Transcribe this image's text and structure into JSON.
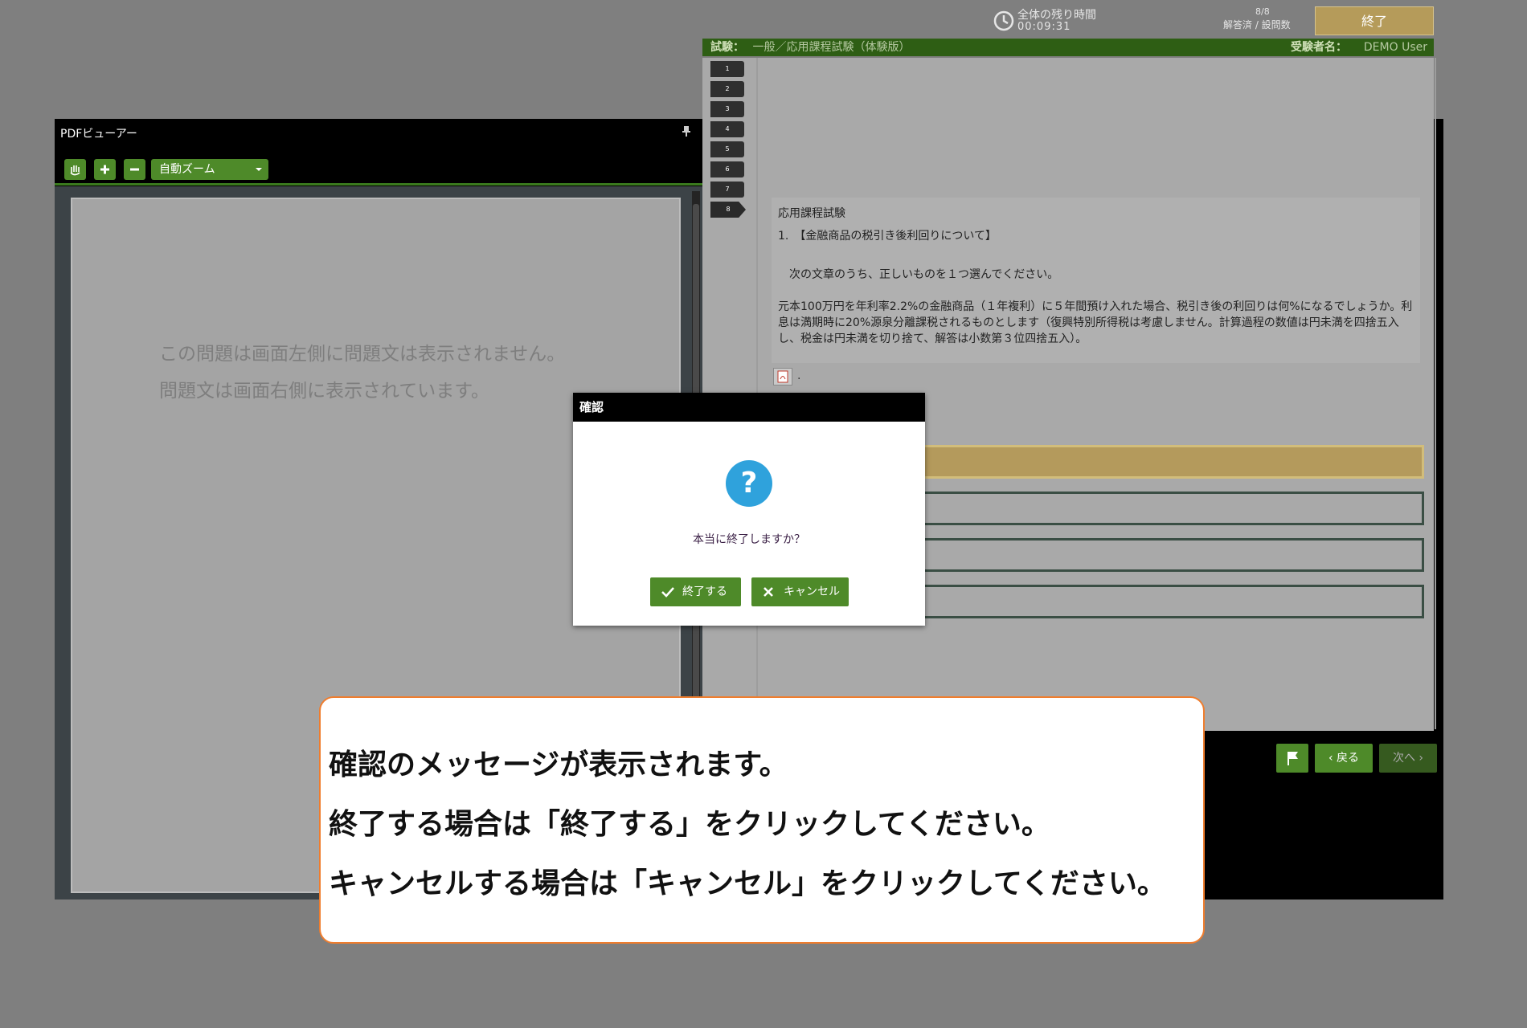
{
  "pdf_viewer": {
    "title": "PDFビューアー",
    "zoom_select": "自動ズーム",
    "message_line1": "この問題は画面左側に問題文は表示されません。",
    "message_line2": "問題文は画面右側に表示されています。"
  },
  "header": {
    "timer_label": "全体の残り時間",
    "timer_value": "00:09:31",
    "progress_value": "8/8",
    "progress_label": "解答済 / 設問数",
    "end_button": "終了"
  },
  "info_bar": {
    "exam_label": "試験：",
    "exam_name": "一般／応用課程試験（体験版）",
    "examinee_label": "受験者名：",
    "examinee_name": "DEMO User"
  },
  "question_nav": [
    "1",
    "2",
    "3",
    "4",
    "5",
    "6",
    "7",
    "8"
  ],
  "question": {
    "course": "応用課程試験",
    "title": "1.　【金融商品の税引き後利回りについて】",
    "instruction": "次の文章のうち、正しいものを１つ選んでください。",
    "body": "元本100万円を年利率2.2%の金融商品（１年複利）に５年間預け入れた場合、税引き後の利回りは何%になるでしょうか。利息は満期時に20%源泉分離課税されるものとします（復興特別所得税は考慮しません。計算過程の数値は円未満を四捨五入し、税金は円未満を切り捨て、解答は小数第３位四捨五入）。",
    "pdf_link_suffix": "."
  },
  "bottom_nav": {
    "back": "戻る",
    "next": "次へ"
  },
  "dialog": {
    "title": "確認",
    "message": "本当に終了しますか？",
    "confirm": "終了する",
    "cancel": "キャンセル"
  },
  "callout": {
    "line1": "確認のメッセージが表示されます。",
    "line2": "終了する場合は「終了する」をクリックしてください。",
    "line3": "キャンセルする場合は「キャンセル」をクリックしてください。"
  },
  "colors": {
    "accent_green": "#4e8a29",
    "gold": "#b59b5a",
    "callout_border": "#ef7d2e",
    "help_blue": "#2fa2dc"
  }
}
